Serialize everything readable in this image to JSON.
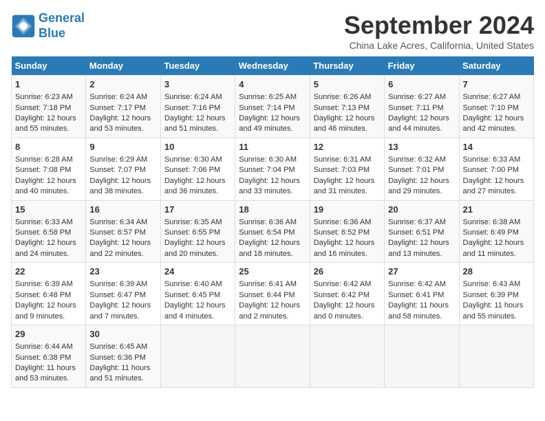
{
  "header": {
    "logo_line1": "General",
    "logo_line2": "Blue",
    "title": "September 2024",
    "subtitle": "China Lake Acres, California, United States"
  },
  "days_of_week": [
    "Sunday",
    "Monday",
    "Tuesday",
    "Wednesday",
    "Thursday",
    "Friday",
    "Saturday"
  ],
  "weeks": [
    [
      {
        "day": "1",
        "lines": [
          "Sunrise: 6:23 AM",
          "Sunset: 7:18 PM",
          "Daylight: 12 hours",
          "and 55 minutes."
        ]
      },
      {
        "day": "2",
        "lines": [
          "Sunrise: 6:24 AM",
          "Sunset: 7:17 PM",
          "Daylight: 12 hours",
          "and 53 minutes."
        ]
      },
      {
        "day": "3",
        "lines": [
          "Sunrise: 6:24 AM",
          "Sunset: 7:16 PM",
          "Daylight: 12 hours",
          "and 51 minutes."
        ]
      },
      {
        "day": "4",
        "lines": [
          "Sunrise: 6:25 AM",
          "Sunset: 7:14 PM",
          "Daylight: 12 hours",
          "and 49 minutes."
        ]
      },
      {
        "day": "5",
        "lines": [
          "Sunrise: 6:26 AM",
          "Sunset: 7:13 PM",
          "Daylight: 12 hours",
          "and 46 minutes."
        ]
      },
      {
        "day": "6",
        "lines": [
          "Sunrise: 6:27 AM",
          "Sunset: 7:11 PM",
          "Daylight: 12 hours",
          "and 44 minutes."
        ]
      },
      {
        "day": "7",
        "lines": [
          "Sunrise: 6:27 AM",
          "Sunset: 7:10 PM",
          "Daylight: 12 hours",
          "and 42 minutes."
        ]
      }
    ],
    [
      {
        "day": "8",
        "lines": [
          "Sunrise: 6:28 AM",
          "Sunset: 7:08 PM",
          "Daylight: 12 hours",
          "and 40 minutes."
        ]
      },
      {
        "day": "9",
        "lines": [
          "Sunrise: 6:29 AM",
          "Sunset: 7:07 PM",
          "Daylight: 12 hours",
          "and 38 minutes."
        ]
      },
      {
        "day": "10",
        "lines": [
          "Sunrise: 6:30 AM",
          "Sunset: 7:06 PM",
          "Daylight: 12 hours",
          "and 36 minutes."
        ]
      },
      {
        "day": "11",
        "lines": [
          "Sunrise: 6:30 AM",
          "Sunset: 7:04 PM",
          "Daylight: 12 hours",
          "and 33 minutes."
        ]
      },
      {
        "day": "12",
        "lines": [
          "Sunrise: 6:31 AM",
          "Sunset: 7:03 PM",
          "Daylight: 12 hours",
          "and 31 minutes."
        ]
      },
      {
        "day": "13",
        "lines": [
          "Sunrise: 6:32 AM",
          "Sunset: 7:01 PM",
          "Daylight: 12 hours",
          "and 29 minutes."
        ]
      },
      {
        "day": "14",
        "lines": [
          "Sunrise: 6:33 AM",
          "Sunset: 7:00 PM",
          "Daylight: 12 hours",
          "and 27 minutes."
        ]
      }
    ],
    [
      {
        "day": "15",
        "lines": [
          "Sunrise: 6:33 AM",
          "Sunset: 6:58 PM",
          "Daylight: 12 hours",
          "and 24 minutes."
        ]
      },
      {
        "day": "16",
        "lines": [
          "Sunrise: 6:34 AM",
          "Sunset: 6:57 PM",
          "Daylight: 12 hours",
          "and 22 minutes."
        ]
      },
      {
        "day": "17",
        "lines": [
          "Sunrise: 6:35 AM",
          "Sunset: 6:55 PM",
          "Daylight: 12 hours",
          "and 20 minutes."
        ]
      },
      {
        "day": "18",
        "lines": [
          "Sunrise: 6:36 AM",
          "Sunset: 6:54 PM",
          "Daylight: 12 hours",
          "and 18 minutes."
        ]
      },
      {
        "day": "19",
        "lines": [
          "Sunrise: 6:36 AM",
          "Sunset: 6:52 PM",
          "Daylight: 12 hours",
          "and 16 minutes."
        ]
      },
      {
        "day": "20",
        "lines": [
          "Sunrise: 6:37 AM",
          "Sunset: 6:51 PM",
          "Daylight: 12 hours",
          "and 13 minutes."
        ]
      },
      {
        "day": "21",
        "lines": [
          "Sunrise: 6:38 AM",
          "Sunset: 6:49 PM",
          "Daylight: 12 hours",
          "and 11 minutes."
        ]
      }
    ],
    [
      {
        "day": "22",
        "lines": [
          "Sunrise: 6:39 AM",
          "Sunset: 6:48 PM",
          "Daylight: 12 hours",
          "and 9 minutes."
        ]
      },
      {
        "day": "23",
        "lines": [
          "Sunrise: 6:39 AM",
          "Sunset: 6:47 PM",
          "Daylight: 12 hours",
          "and 7 minutes."
        ]
      },
      {
        "day": "24",
        "lines": [
          "Sunrise: 6:40 AM",
          "Sunset: 6:45 PM",
          "Daylight: 12 hours",
          "and 4 minutes."
        ]
      },
      {
        "day": "25",
        "lines": [
          "Sunrise: 6:41 AM",
          "Sunset: 6:44 PM",
          "Daylight: 12 hours",
          "and 2 minutes."
        ]
      },
      {
        "day": "26",
        "lines": [
          "Sunrise: 6:42 AM",
          "Sunset: 6:42 PM",
          "Daylight: 12 hours",
          "and 0 minutes."
        ]
      },
      {
        "day": "27",
        "lines": [
          "Sunrise: 6:42 AM",
          "Sunset: 6:41 PM",
          "Daylight: 11 hours",
          "and 58 minutes."
        ]
      },
      {
        "day": "28",
        "lines": [
          "Sunrise: 6:43 AM",
          "Sunset: 6:39 PM",
          "Daylight: 11 hours",
          "and 55 minutes."
        ]
      }
    ],
    [
      {
        "day": "29",
        "lines": [
          "Sunrise: 6:44 AM",
          "Sunset: 6:38 PM",
          "Daylight: 11 hours",
          "and 53 minutes."
        ]
      },
      {
        "day": "30",
        "lines": [
          "Sunrise: 6:45 AM",
          "Sunset: 6:36 PM",
          "Daylight: 11 hours",
          "and 51 minutes."
        ]
      },
      {
        "day": "",
        "lines": [],
        "empty": true
      },
      {
        "day": "",
        "lines": [],
        "empty": true
      },
      {
        "day": "",
        "lines": [],
        "empty": true
      },
      {
        "day": "",
        "lines": [],
        "empty": true
      },
      {
        "day": "",
        "lines": [],
        "empty": true
      }
    ]
  ]
}
